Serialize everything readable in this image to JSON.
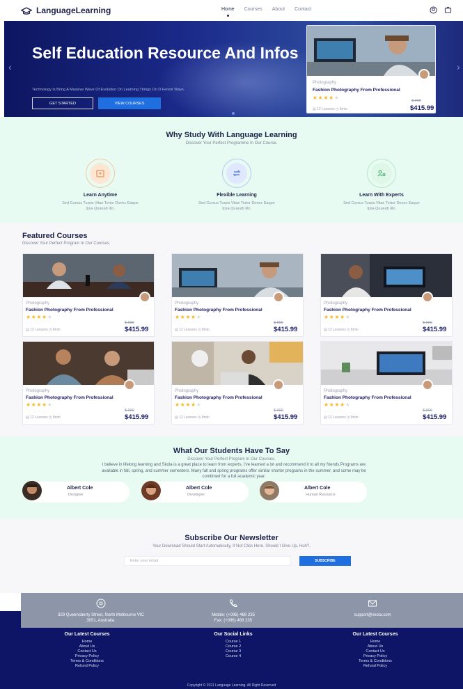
{
  "nav": {
    "brand": "LanguageLearning",
    "menu": [
      "Home",
      "Courses",
      "About",
      "Contact"
    ]
  },
  "hero": {
    "title": "Self Education Resource And Infos",
    "subtitle": "Technology Is Bring A Massive Wave Of Evolution On Learning Things On D Ferent Ways.",
    "btn_start": "GET STARTED",
    "btn_view": "VIEW COURSES",
    "card": {
      "category": "Photography",
      "title": "Fashion Photography From Professional",
      "lessons": "12 Lessons",
      "time": "8min",
      "old_price": "$ 999",
      "price": "$415.99"
    }
  },
  "why": {
    "title": "Why Study With Language Learning",
    "subtitle": "Discover Your Perfect Programme In Our Course.",
    "features": [
      {
        "title": "Learn Anytime",
        "desc1": "Sed Cursus Turpis Vitae Tortor Donec Eaque",
        "desc2": "Ipsa Quaeab Illo."
      },
      {
        "title": "Flexible Learning",
        "desc1": "Sed Cursus Turpis Vitae Tortor Donec Eaque",
        "desc2": "Ipsa Quaeab Illo."
      },
      {
        "title": "Learn With Experts",
        "desc1": "Sed Cursus Turpis Vitae Tortor Donec Eaque",
        "desc2": "Ipsa Quaeab Illo."
      }
    ]
  },
  "featured": {
    "title": "Featured Courses",
    "subtitle": "Discover Your Perfect Program In Our Courses.",
    "courses": [
      {
        "category": "Photography",
        "title": "Fashion Photography From Professional",
        "lessons": "12 Lessons",
        "time": "8min",
        "old_price": "$ 999",
        "price": "$415.99"
      },
      {
        "category": "Photography",
        "title": "Fashion Photography From Professional",
        "lessons": "12 Lessons",
        "time": "8min",
        "old_price": "$ 999",
        "price": "$415.99"
      },
      {
        "category": "Photography",
        "title": "Fashion Photography From Professional",
        "lessons": "12 Lessons",
        "time": "8min",
        "old_price": "$ 999",
        "price": "$415.99"
      },
      {
        "category": "Photography",
        "title": "Fashion Photography From Professional",
        "lessons": "12 Lessons",
        "time": "8min",
        "old_price": "$ 999",
        "price": "$415.99"
      },
      {
        "category": "Photography",
        "title": "Fashion Photography From Professional",
        "lessons": "12 Lessons",
        "time": "8min",
        "old_price": "$ 999",
        "price": "$415.99"
      },
      {
        "category": "Photography",
        "title": "Fashion Photography From Professional",
        "lessons": "12 Lessons",
        "time": "8min",
        "old_price": "$ 999",
        "price": "$415.99"
      }
    ]
  },
  "testimonials": {
    "title": "What Our Students Have To Say",
    "subtitle": "Discover Your Perfect Program In Our Courses.",
    "quote1": "I believe in lifelong learning and Skola is a great place to learn from experts. I've learned a lot and recommend it to all my friends.Programs are",
    "quote2": "available in fall, spring, and summer semesters. Many fall and spring programs offer similar shorter programs in the summer, and some may be",
    "quote3": "combined for a full academic year.",
    "people": [
      {
        "name": "Albert Cole",
        "role": "Designer"
      },
      {
        "name": "Albert Cole",
        "role": "Developer"
      },
      {
        "name": "Albert Cole",
        "role": "Human Resource"
      }
    ]
  },
  "newsletter": {
    "title": "Subscribe Our Newsletter",
    "subtitle": "Your Download Should Start Automatically, If Not Click Here. Should I Give Up, Huh?.",
    "placeholder": "Enter your email",
    "button": "SUBSCRIBE"
  },
  "contact": {
    "address1": "329 Queensberry Street, North Melbourne VIC",
    "address2": "3051, Australia.",
    "phone1": "Mobile: (+096) 468 235",
    "phone2": "Fax: (+096) 468 235",
    "email": "support@skola.com"
  },
  "footer": {
    "col1": {
      "title": "Our Latest Courses",
      "links": [
        "Home",
        "About Us",
        "Contact Us",
        "Privacy Policy",
        "Terms & Conditions",
        "Refund Policy"
      ]
    },
    "col2": {
      "title": "Our Social Links",
      "links": [
        "Course 1",
        "Course 2",
        "Course 3",
        "Course 4"
      ]
    },
    "col3": {
      "title": "Our Latest Courses",
      "links": [
        "Home",
        "About Us",
        "Contact Us",
        "Privacy Policy",
        "Terms & Conditions",
        "Refund Policy"
      ]
    },
    "copyright": "Copyright © 2021 Language Learning. All Right Reserved"
  },
  "rating": {
    "stars_on": 4,
    "stars_total": 5
  },
  "colors": {
    "navy": "#0e1566",
    "accent": "#1f6fe0",
    "mint": "#e8fbf2",
    "star": "#f3b92e"
  }
}
